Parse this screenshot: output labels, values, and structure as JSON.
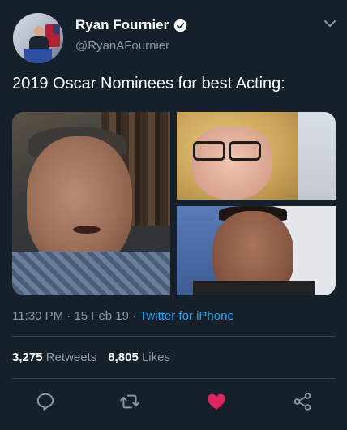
{
  "author": {
    "name": "Ryan Fournier",
    "handle": "@RyanAFournier"
  },
  "tweet": {
    "text": "2019 Oscar Nominees for best Acting:"
  },
  "meta": {
    "time": "11:30 PM",
    "separator1": " · ",
    "date": "15 Feb 19",
    "separator2": " · ",
    "source": "Twitter for iPhone"
  },
  "stats": {
    "retweets_count": "3,275",
    "retweets_label": "Retweets",
    "likes_count": "8,805",
    "likes_label": "Likes"
  },
  "colors": {
    "background": "#15202b",
    "secondary_text": "#8899a6",
    "link": "#1da1f2",
    "like_active": "#e0245e",
    "divider": "#38444d"
  },
  "icons": {
    "verified": "verified-badge-icon",
    "caret": "chevron-down-icon",
    "reply": "reply-icon",
    "retweet": "retweet-icon",
    "like": "heart-icon",
    "share": "share-icon"
  }
}
